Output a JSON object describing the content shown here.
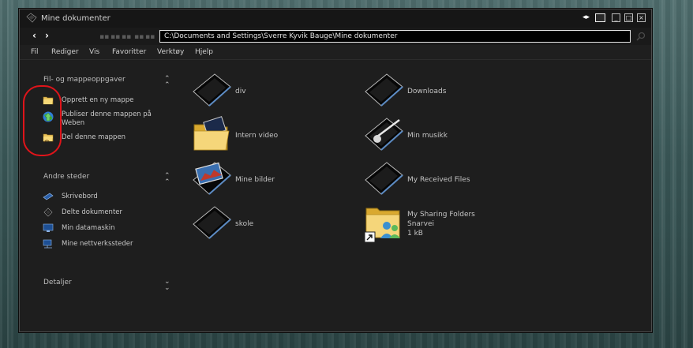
{
  "window": {
    "title": "Mine dokumenter",
    "arrows": "◂▸",
    "minimize": "_",
    "maximize": "□",
    "close": "×"
  },
  "toolbar": {
    "back": "‹",
    "forward": "›",
    "address": "C:\\Documents and Settings\\Sverre Kyvik Bauge\\Mine dokumenter"
  },
  "menu": [
    "Fil",
    "Rediger",
    "Vis",
    "Favoritter",
    "Verktøy",
    "Hjelp"
  ],
  "tasks": {
    "title": "Fil- og mappeoppgaver",
    "items": [
      {
        "label": "Opprett en ny mappe",
        "icon": "new-folder-icon"
      },
      {
        "label": "Publiser denne mappen på Weben",
        "icon": "publish-web-icon"
      },
      {
        "label": "Del denne mappen",
        "icon": "share-folder-icon"
      }
    ]
  },
  "places": {
    "title": "Andre steder",
    "items": [
      {
        "label": "Skrivebord",
        "icon": "desktop-icon"
      },
      {
        "label": "Delte dokumenter",
        "icon": "shared-documents-icon"
      },
      {
        "label": "Min datamaskin",
        "icon": "my-computer-icon"
      },
      {
        "label": "Mine nettverkssteder",
        "icon": "network-places-icon"
      }
    ]
  },
  "details": {
    "title": "Detaljer"
  },
  "files": [
    {
      "name": "div",
      "icon": "dark-folder-icon"
    },
    {
      "name": "Downloads",
      "icon": "dark-folder-icon"
    },
    {
      "name": "Intern video",
      "icon": "video-folder-icon"
    },
    {
      "name": "Min musikk",
      "icon": "music-folder-icon"
    },
    {
      "name": "Mine bilder",
      "icon": "pictures-folder-icon"
    },
    {
      "name": "My Received Files",
      "icon": "dark-folder-icon"
    },
    {
      "name": "skole",
      "icon": "dark-folder-icon"
    },
    {
      "name": "My Sharing Folders",
      "sub1": "Snarvei",
      "sub2": "1 kB",
      "icon": "sharing-shortcut-icon"
    }
  ],
  "colors": {
    "window_bg": "#202020",
    "accent_annotation": "#e0141a",
    "desktop": "#3f5d5d"
  }
}
